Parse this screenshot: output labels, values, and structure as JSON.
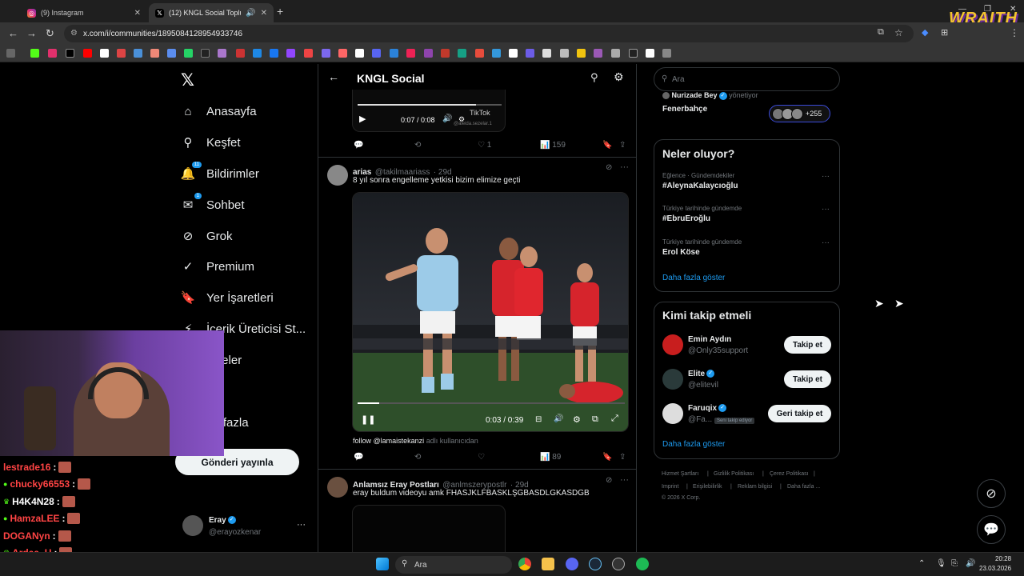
{
  "browser": {
    "tabs": [
      {
        "title": "(9) Instagram",
        "icon": "instagram-icon",
        "color": "#e1306c"
      },
      {
        "title": "(12) KNGL Social Topluluk / ",
        "icon": "x-icon",
        "color": "#ffffff"
      }
    ],
    "url": "x.com/i/communities/1895084128954933746",
    "overlay_logo": "WRAITH"
  },
  "nav": {
    "items": [
      {
        "label": "Anasayfa",
        "icon": "home-icon",
        "glyph": "⌂"
      },
      {
        "label": "Keşfet",
        "icon": "search-icon",
        "glyph": "⚲"
      },
      {
        "label": "Bildirimler",
        "icon": "bell-icon",
        "glyph": "🔔",
        "badge": "11"
      },
      {
        "label": "Sohbet",
        "icon": "mail-icon",
        "glyph": "✉",
        "badge": "1"
      },
      {
        "label": "Grok",
        "icon": "grok-icon",
        "glyph": "⊘"
      },
      {
        "label": "Premium",
        "icon": "premium-icon",
        "glyph": "✓"
      },
      {
        "label": "Yer İşaretleri",
        "icon": "bookmark-icon",
        "glyph": "🔖"
      },
      {
        "label": "İçerik Üreticisi St...",
        "icon": "creator-icon",
        "glyph": "⚡"
      },
      {
        "label": "kaleler",
        "icon": "list-icon",
        "glyph": ""
      },
      {
        "label": "fil",
        "icon": "profile-icon",
        "glyph": ""
      },
      {
        "label": "ha fazla",
        "icon": "more-icon",
        "glyph": ""
      }
    ],
    "post_button": "Gönderi yayınla",
    "profile": {
      "name": "Eray",
      "handle": "@erayozkenar",
      "more": "···"
    }
  },
  "chat": [
    {
      "user": "lestrade16",
      "color": "#ff4444",
      "sep": ":",
      "badge": ""
    },
    {
      "user": "chucky66553",
      "color": "#ff4444",
      "sep": ":",
      "badge": "●"
    },
    {
      "user": "H4K4N28",
      "color": "#ffffff",
      "sep": ":",
      "badge": "♛"
    },
    {
      "user": "HamzaLEE",
      "color": "#ff4444",
      "sep": ":",
      "badge": "●"
    },
    {
      "user": "DOGANyn",
      "color": "#ff4444",
      "sep": ":",
      "badge": ""
    },
    {
      "user": "Ardaa_U",
      "color": "#ff4444",
      "sep": ":",
      "badge": "♛"
    },
    {
      "user": "eylulac",
      "color": "#ffffff",
      "sep": ":",
      "badge": ""
    }
  ],
  "main": {
    "title": "KNGL Social",
    "post1": {
      "time": "0:07 / 0:08",
      "watermark": "TikTok",
      "watermark_handle": "@aleida.sezelar.1",
      "likes": "1",
      "views": "159"
    },
    "post2": {
      "name": "arias",
      "handle": "@takilmaariass",
      "age": "· 29d",
      "text": "8 yıl sonra engelleme yetkisi bizim elimize geçti",
      "video_time": "0:03 / 0:39",
      "caption_user": "follow @lamaistekanzi",
      "caption_suffix": "adlı kullanıcıdan",
      "views": "89"
    },
    "post3": {
      "name": "Anlamsız Eray Postları",
      "handle": "@anlmszerypostlr",
      "age": "· 29d",
      "text": "eray buldum videoyu amk FHASJKLFBASKLŞGBASDLGKASDGB"
    }
  },
  "right": {
    "search_placeholder": "Ara",
    "community_card": {
      "moderator": "Nurizade Bey",
      "moderator_role": "yönetiyor",
      "community": "Fenerbahçe",
      "member_count": "+255"
    },
    "trends": {
      "title": "Neler oluyor?",
      "items": [
        {
          "meta": "Eğlence · Gündemdekiler",
          "name": "#AleynaKalaycıoğlu"
        },
        {
          "meta": "Türkiye tarihinde gündemde",
          "name": "#EbruEroğlu"
        },
        {
          "meta": "Türkiye tarihinde gündemde",
          "name": "Erol Köse"
        }
      ],
      "more": "Daha fazla göster"
    },
    "who_to_follow": {
      "title": "Kimi takip etmeli",
      "items": [
        {
          "name": "Emin Aydın",
          "handle": "@Only35support",
          "button": "Takip et",
          "verified": false,
          "note": ""
        },
        {
          "name": "Elite",
          "handle": "@elitevil",
          "button": "Takip et",
          "verified": true,
          "note": ""
        },
        {
          "name": "Faruqix",
          "handle": "@Fa...",
          "button": "Geri takip et",
          "verified": true,
          "note": "Seni takip ediyor"
        }
      ],
      "more": "Daha fazla göster"
    },
    "footer": {
      "row1": [
        "Hizmet Şartları",
        "Gizlilik Politikası",
        "Çerez Politikası"
      ],
      "row2": [
        "Imprint",
        "Erişilebilirlik",
        "Reklam bilgisi",
        "Daha fazla ..."
      ],
      "copyright": "© 2026 X Corp."
    }
  },
  "taskbar": {
    "search": "Ara",
    "time": "20:28",
    "date": "23.03.2026"
  }
}
